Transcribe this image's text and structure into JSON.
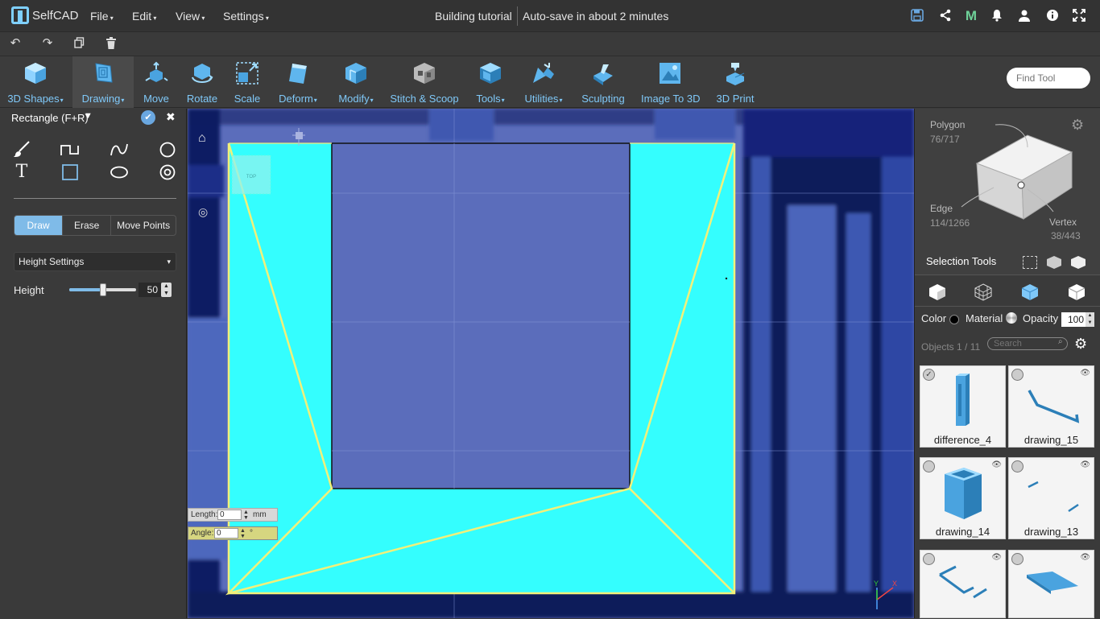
{
  "app": {
    "name": "SelfCAD"
  },
  "menu": [
    "File",
    "Edit",
    "View",
    "Settings"
  ],
  "document": {
    "title": "Building tutorial",
    "autosave": "Auto-save in about 2 minutes"
  },
  "toolbar": {
    "tools": [
      "3D Shapes",
      "Drawing",
      "Move",
      "Rotate",
      "Scale",
      "Deform",
      "Modify",
      "Stitch & Scoop",
      "Tools",
      "Utilities",
      "Sculpting",
      "Image To 3D",
      "3D Print"
    ],
    "find_placeholder": "Find Tool"
  },
  "left_panel": {
    "title": "Rectangle (F+R)",
    "modes": [
      "Draw",
      "Erase",
      "Move Points"
    ],
    "settings_select": "Height Settings",
    "height_label": "Height",
    "height_value": "50",
    "height_fraction": 0.5
  },
  "viewport": {
    "cube_label": "TOP",
    "length_label": "Length:",
    "length_value": "0",
    "length_unit": "mm",
    "angle_label": "Angle:",
    "angle_value": "0",
    "angle_unit": "°",
    "axis_y": "Y",
    "axis_x": "X"
  },
  "right_panel": {
    "polygon_label": "Polygon",
    "polygon_value": "76/717",
    "edge_label": "Edge",
    "edge_value": "114/1266",
    "vertex_label": "Vertex",
    "vertex_value": "38/443",
    "selection_tools": "Selection Tools",
    "color_label": "Color",
    "material_label": "Material",
    "opacity_label": "Opacity",
    "opacity_value": "100",
    "objects_count": "Objects 1 / 11",
    "search_placeholder": "Search",
    "objects": [
      "difference_4",
      "drawing_15",
      "drawing_14",
      "drawing_13"
    ]
  }
}
